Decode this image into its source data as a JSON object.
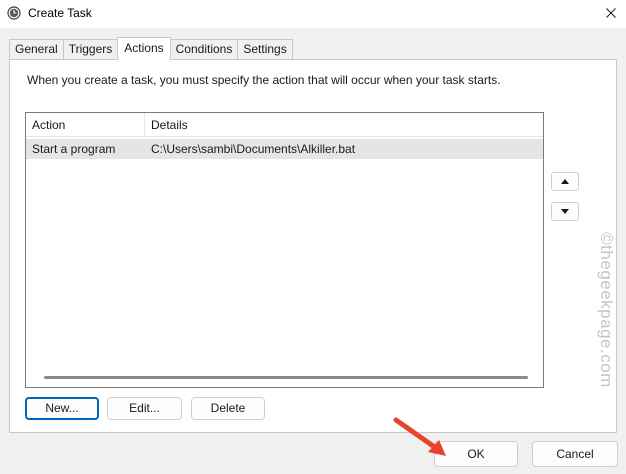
{
  "window": {
    "title": "Create Task"
  },
  "tabs": [
    {
      "label": "General",
      "active": false
    },
    {
      "label": "Triggers",
      "active": false
    },
    {
      "label": "Actions",
      "active": true
    },
    {
      "label": "Conditions",
      "active": false
    },
    {
      "label": "Settings",
      "active": false
    }
  ],
  "actions_tab": {
    "description": "When you create a task, you must specify the action that will occur when your task starts.",
    "columns": [
      "Action",
      "Details"
    ],
    "rows": [
      {
        "action": "Start a program",
        "details": "C:\\Users\\sambi\\Documents\\Alkiller.bat"
      }
    ],
    "buttons": {
      "new": "New...",
      "edit": "Edit...",
      "delete": "Delete"
    }
  },
  "footer": {
    "ok": "OK",
    "cancel": "Cancel"
  },
  "watermark": "©thegeekpage.com",
  "colors": {
    "accent": "#0067c0",
    "annotation_arrow": "#e8412c",
    "selected_row": "#e5e5e5"
  },
  "icons": [
    "clock-icon",
    "close-icon",
    "move-up-icon",
    "move-down-icon",
    "red-arrow-annotation"
  ]
}
